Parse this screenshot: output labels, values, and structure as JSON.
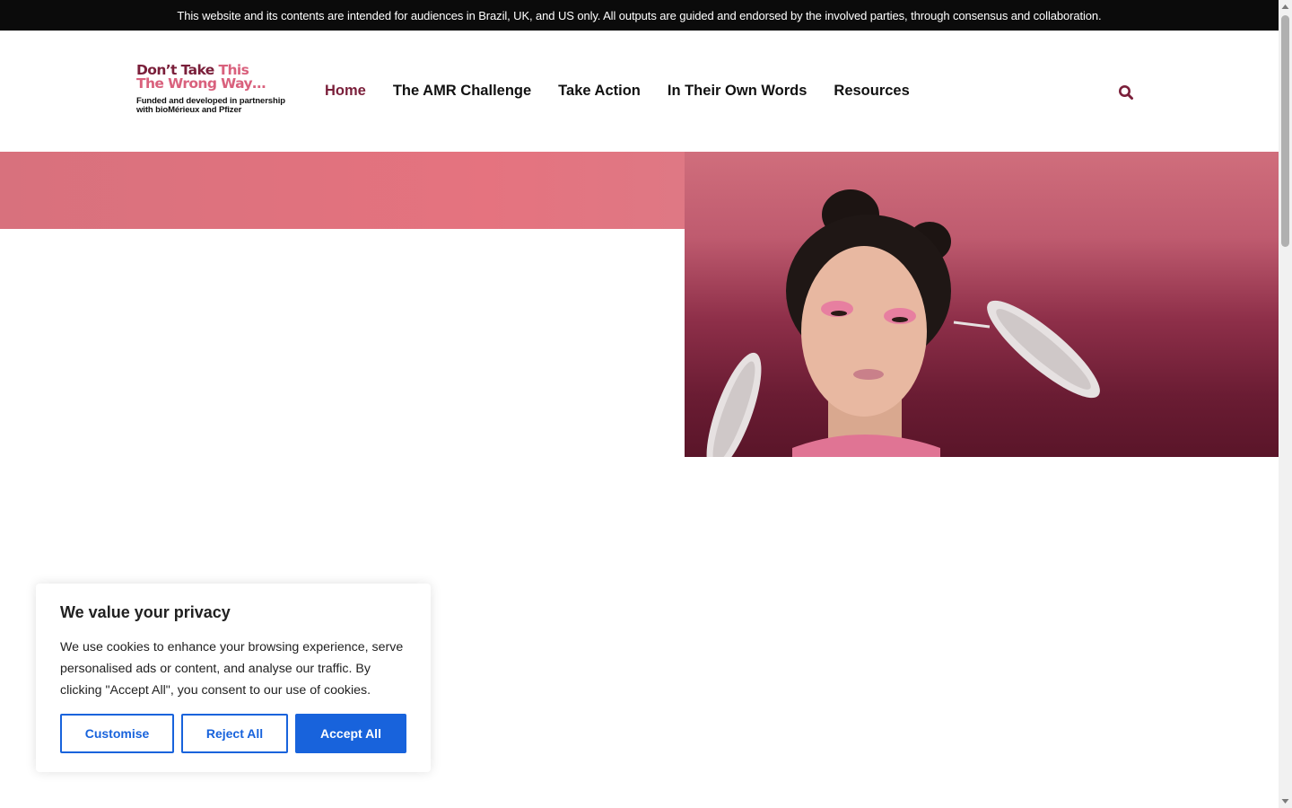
{
  "banner": {
    "text": "This website and its contents are intended for audiences in Brazil, UK, and US only. All outputs are guided and endorsed by the involved parties, through consensus and collaboration."
  },
  "logo": {
    "line1_a": "Don’t Take",
    "line1_b": " This",
    "line2": "The Wrong Way…",
    "sub_line1": "Funded and developed in partnership",
    "sub_line2": "with bioMérieux and Pfizer"
  },
  "nav": {
    "items": [
      {
        "label": "Home",
        "active": true
      },
      {
        "label": "The AMR Challenge",
        "active": false
      },
      {
        "label": "Take Action",
        "active": false
      },
      {
        "label": "In Their Own Words",
        "active": false
      },
      {
        "label": "Resources",
        "active": false
      }
    ],
    "search_icon": "search-icon"
  },
  "cookie": {
    "title": "We value your privacy",
    "text": "We use cookies to enhance your browsing experience, serve personalised ads or content, and analyse our traffic. By clicking \"Accept All\", you consent to our use of cookies.",
    "customise_label": "Customise",
    "reject_label": "Reject All",
    "accept_label": "Accept All"
  },
  "colors": {
    "brand_dark": "#7a1f3a",
    "brand_pink": "#d9617d",
    "cookie_blue": "#1863dc",
    "banner_bg": "#0b0b0b"
  }
}
